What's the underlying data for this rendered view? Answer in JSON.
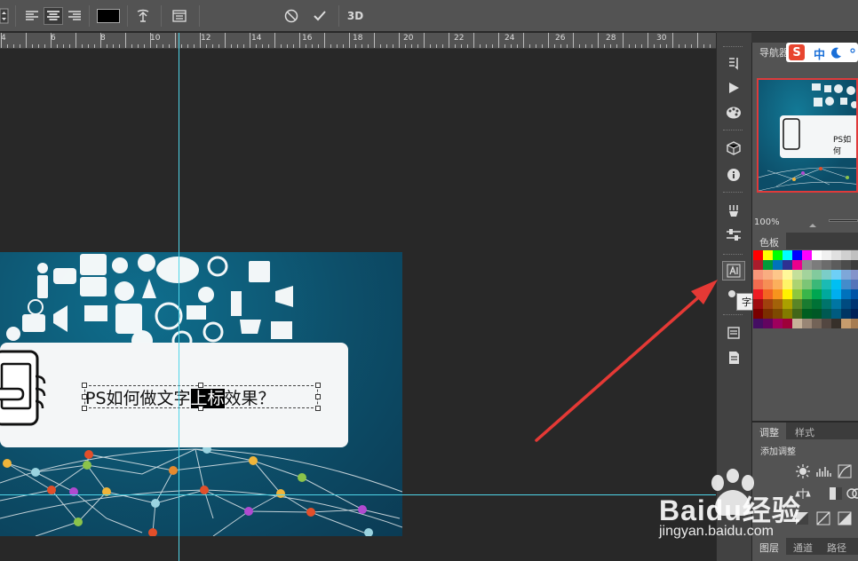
{
  "toolbar": {
    "view3d_label": "3D"
  },
  "ruler": {
    "ticks": [
      "4",
      "6",
      "8",
      "10",
      "12",
      "14",
      "16",
      "18",
      "20",
      "22",
      "24",
      "26",
      "28",
      "30"
    ]
  },
  "canvas": {
    "headline_pre": "PS如何做文字",
    "headline_sel": "上标",
    "headline_post": "效果？"
  },
  "dock": {
    "tooltip": "字符"
  },
  "navigator": {
    "tab_label": "导航器",
    "thumb_text": "PS如何",
    "zoom": "100%"
  },
  "swatches": {
    "tab_label": "色板",
    "colors": [
      "#ff0000",
      "#ffff00",
      "#00ff00",
      "#00ffff",
      "#0000ff",
      "#ff00ff",
      "#ffffff",
      "#f0f0f0",
      "#e0e0e0",
      "#d0d0d0",
      "#c0c0c0",
      "#a81c2c",
      "#009a3a",
      "#0072bc",
      "#2e3192",
      "#ec008c",
      "#8c8c8c",
      "#7c7c7c",
      "#6c6c6c",
      "#5c5c5c",
      "#4c4c4c",
      "#3c3c3c",
      "#f7977a",
      "#f9ad81",
      "#fdc68a",
      "#fff79a",
      "#c4df9b",
      "#a3d39c",
      "#82ca9d",
      "#7bcdc8",
      "#6ecff6",
      "#7ea7d8",
      "#8493ca",
      "#f26c4f",
      "#f68e55",
      "#fbaf5c",
      "#fff467",
      "#acd372",
      "#7cc576",
      "#3bb878",
      "#1abbb4",
      "#00bff3",
      "#438ccb",
      "#5574b9",
      "#ed1c24",
      "#f26522",
      "#f7941d",
      "#fff200",
      "#8dc73f",
      "#39b54a",
      "#00a651",
      "#00a99d",
      "#00aeef",
      "#0072bc",
      "#0054a6",
      "#9e0b0f",
      "#a0410d",
      "#a36209",
      "#aba000",
      "#598527",
      "#1a7b30",
      "#007236",
      "#00746b",
      "#0076a3",
      "#004b80",
      "#003471",
      "#790000",
      "#7b2e00",
      "#7d4900",
      "#827b00",
      "#406618",
      "#005e20",
      "#005826",
      "#005952",
      "#005b7f",
      "#003663",
      "#002157",
      "#440e62",
      "#630460",
      "#9e005d",
      "#9e0039",
      "#c7b299",
      "#998675",
      "#736357",
      "#534741",
      "#37302a",
      "#c69c6d",
      "#a67c52"
    ]
  },
  "adjust": {
    "tab1": "调整",
    "tab2": "样式",
    "add_label": "添加调整"
  },
  "layers": {
    "tab1": "图层",
    "tab2": "通道",
    "tab3": "路径"
  },
  "ime": {
    "logo": "S",
    "zh": "中"
  },
  "watermark": {
    "brand": "Baidu经验",
    "url": "jingyan.baidu.com"
  }
}
